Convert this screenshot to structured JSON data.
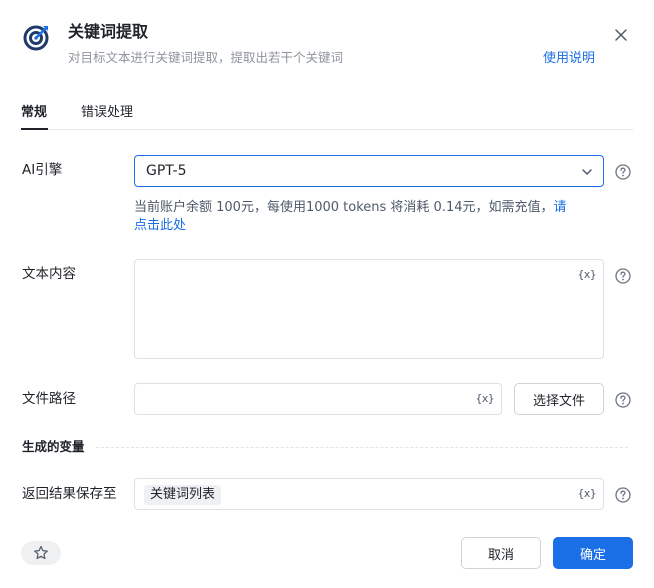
{
  "header": {
    "title": "关键词提取",
    "subtitle": "对目标文本进行关键词提取，提取出若干个关键词",
    "help_link": "使用说明",
    "icon": "target-arrow-icon",
    "close_icon": "close-icon"
  },
  "tabs": [
    {
      "label": "常规",
      "active": true
    },
    {
      "label": "错误处理",
      "active": false
    }
  ],
  "fields": {
    "engine": {
      "label": "AI引擎",
      "value": "GPT-5",
      "hint_text": "当前账户余额 100元，每使用1000 tokens 将消耗 0.14元，如需充值，",
      "hint_link_1": "请",
      "hint_link_2": "点击此处"
    },
    "text_content": {
      "label": "文本内容",
      "value": "",
      "var_icon": "{x}"
    },
    "file_path": {
      "label": "文件路径",
      "value": "",
      "var_icon": "{x}",
      "button": "选择文件"
    }
  },
  "output_section": {
    "title": "生成的变量",
    "save_label": "返回结果保存至",
    "save_value": "关键词列表",
    "var_icon": "{x}"
  },
  "footer": {
    "favorite_icon": "star-icon",
    "cancel": "取消",
    "confirm": "确定"
  },
  "colors": {
    "accent": "#1a6ee6",
    "text": "#1f2329",
    "muted": "#8f959e",
    "border": "#dde0e4"
  }
}
